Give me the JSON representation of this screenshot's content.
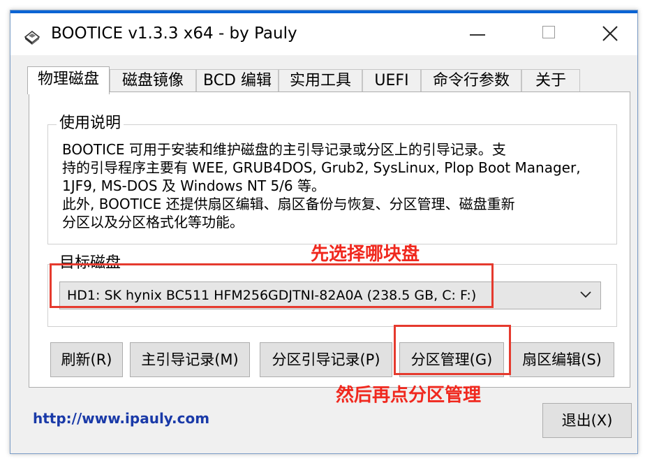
{
  "window": {
    "title": "BOOTICE v1.3.3 x64 - by Pauly",
    "accent_color": "#0a64d4"
  },
  "tabs": [
    {
      "label": "物理磁盘",
      "active": true
    },
    {
      "label": "磁盘镜像"
    },
    {
      "label": "BCD 编辑"
    },
    {
      "label": "实用工具"
    },
    {
      "label": "UEFI"
    },
    {
      "label": "命令行参数"
    },
    {
      "label": "关于"
    }
  ],
  "usage": {
    "legend": "使用说明",
    "lines": [
      "BOOTICE 可用于安装和维护磁盘的主引导记录或分区上的引导记录。支",
      "持的引导程序主要有 WEE, GRUB4DOS, Grub2, SysLinux, Plop Boot Manager,",
      "1JF9, MS-DOS 及 Windows NT 5/6 等。",
      "此外, BOOTICE 还提供扇区编辑、扇区备份与恢复、分区管理、磁盘重新",
      "分区以及分区格式化等功能。"
    ]
  },
  "target_disk": {
    "legend": "目标磁盘",
    "selected": "HD1: SK hynix BC511 HFM256GDJTNI-82A0A (238.5 GB, C: F:)"
  },
  "buttons": {
    "refresh": "刷新(R)",
    "mbr": "主引导记录(M)",
    "pbr": "分区引导记录(P)",
    "parts_manage": "分区管理(G)",
    "sector_edit": "扇区编辑(S)",
    "exit": "退出(X)"
  },
  "link": "http://www.ipauly.com",
  "annotations": {
    "select_disk": "先选择哪块盘",
    "then_manage": "然后再点分区管理",
    "color": "#e53a2e"
  }
}
